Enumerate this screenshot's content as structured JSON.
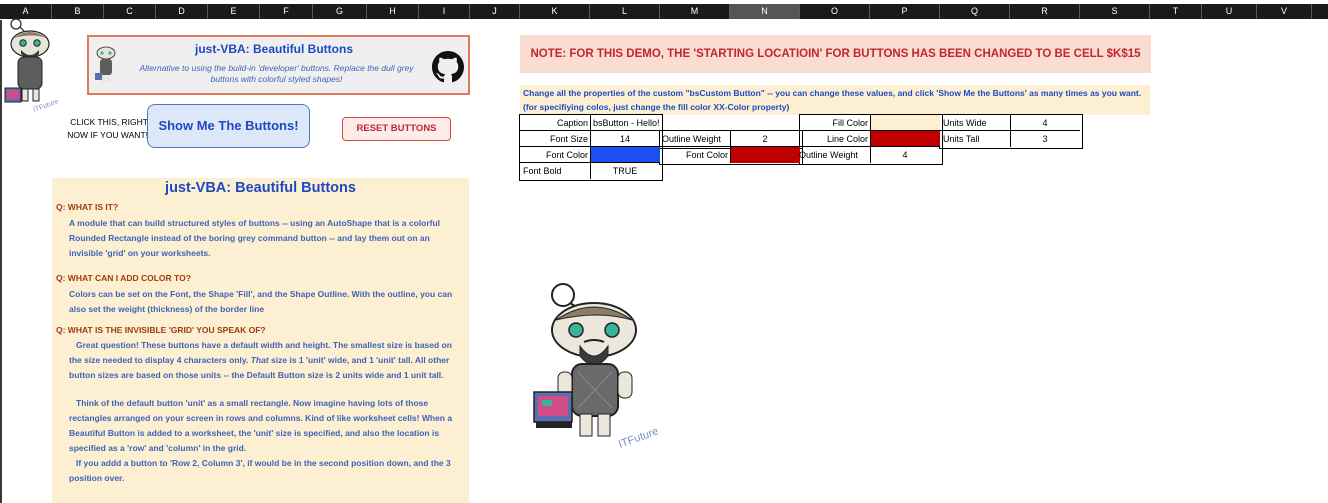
{
  "sheet": {
    "columns": [
      "A",
      "B",
      "C",
      "D",
      "E",
      "F",
      "G",
      "H",
      "I",
      "J",
      "K",
      "L",
      "M",
      "N",
      "O",
      "P",
      "Q",
      "R",
      "S",
      "T",
      "U",
      "V"
    ],
    "selected_column": "N"
  },
  "title_card": {
    "title": "just-VBA: Beautiful Buttons",
    "subtitle": "Alternative to using the build-in 'developer' buttons.  Replace the dull grey buttons with colorful styled shapes!"
  },
  "mascot": {
    "label": "ITFuture"
  },
  "click_note": "CLICK THIS, RIGHT NOW IF YOU WANT!",
  "buttons": {
    "show": "Show Me The Buttons!",
    "reset": "RESET BUTTONS"
  },
  "faq": {
    "title": "just-VBA: Beautiful Buttons",
    "q1": "Q: WHAT IS IT?",
    "a1": "A module that can build structured styles of buttons -- using an AutoShape that is a colorful Rounded Rectangle instead of the boring grey command button --  and lay them out on an invisible 'grid' on your worksheets.",
    "q2": "Q: WHAT CAN I ADD COLOR TO?",
    "a2": "Colors can be set on the Font, the Shape 'Fill', and the Shape Outline.  With the outline, you can also set the weight (thickness) of the border line",
    "q3": "Q: WHAT IS THE INVISIBLE 'GRID' YOU SPEAK OF?",
    "a3_p1a": "Great question!  These buttons have a default width and height.  The smallest size is based on the size needed to display 4 characters only. ",
    "a3_p1em": "That",
    "a3_p1b": " size is 1 'unit' wide, and 1 'unit' tall.  All other button sizes are based on those units -- the Default Button size is 2 units wide and 1 unit tall.",
    "a3_p2": "Think of the default button 'unit' as a small rectangle.  Now imagine having lots of those rectangles arranged on your screen in rows and columns.  Kind of like worksheet cells!  When a Beautiful Button is added to a worksheet, the 'unit' size is specified,  and also the location is specified as a 'row' and 'column' in the grid.",
    "a3_p3": "If you addd a button to 'Row 2, Column 3', if would be in the second position down, and the 3 position over."
  },
  "note": "NOTE: FOR THIS DEMO, THE 'STARTING LOCATIOIN' FOR BUTTONS HAS BEEN CHANGED TO BE CELL $K$15",
  "change_text": "Change all the properties of the custom \"bsCustom Button\" -- you can change these values, and click 'Show Me the Buttons' as many times as you want.  (for specifiying colos, just change the fill color XX-Color property)",
  "props": {
    "caption_label": "Caption",
    "caption_value": "bsButton - Hello!",
    "font_size_label": "Font Size",
    "font_size_value": "14",
    "font_color_label": "Font Color",
    "font_color_value": "#1a4ff0",
    "font_bold_label": "Font Bold",
    "font_bold_value": "TRUE",
    "outline_weight_label": "Outline Weight",
    "outline_weight_value": "2",
    "font_color2_label": "Font Color",
    "font_color2_value": "#c00000",
    "fill_color_label": "Fill Color",
    "fill_color_value": "#fdf0d2",
    "line_color_label": "Line Color",
    "line_color_value": "#c00000",
    "outline_weight2_label": "Outline Weight",
    "outline_weight2_value": "4",
    "units_wide_label": "Units Wide",
    "units_wide_value": "4",
    "units_tall_label": "Units Tall",
    "units_tall_value": "3"
  }
}
